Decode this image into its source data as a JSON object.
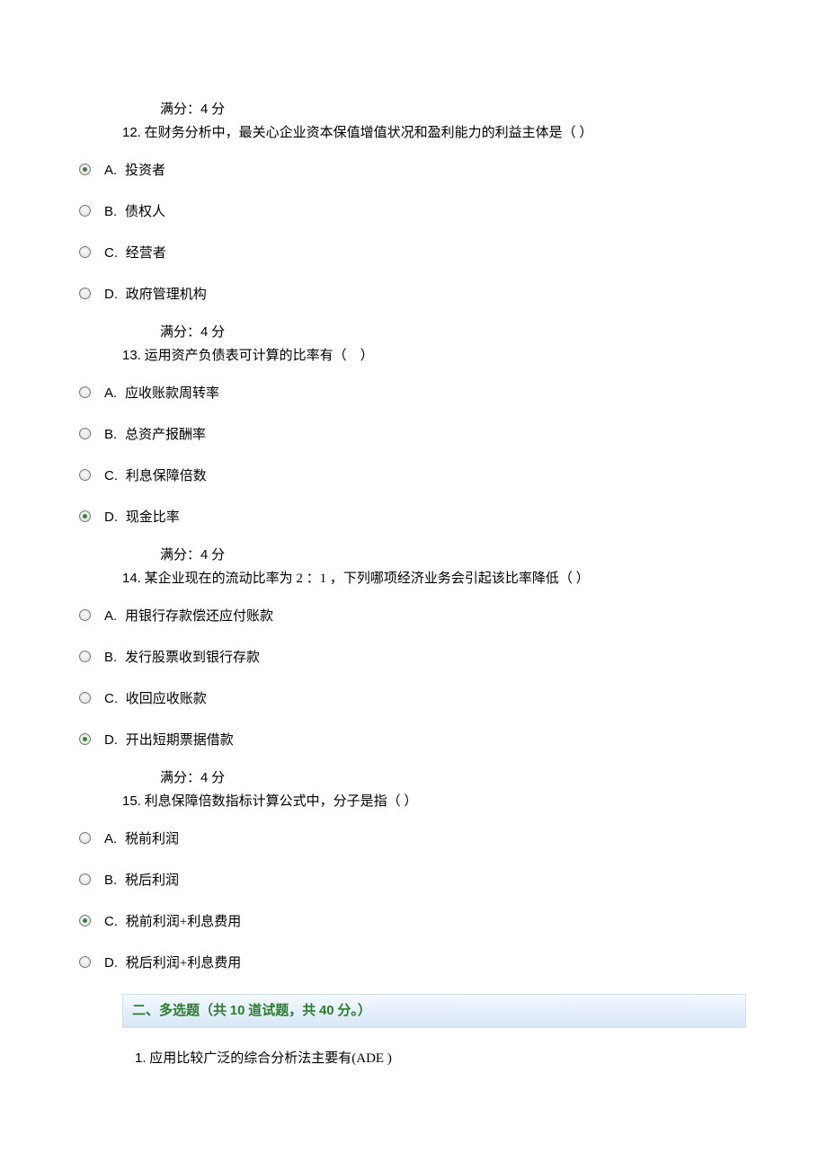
{
  "score_label_prefix": "满分：",
  "score_value": "4",
  "score_label_suffix": " 分",
  "questions": [
    {
      "number": "12.",
      "text": " 在财务分析中，最关心企业资本保值增值状况和盈利能力的利益主体是（ ）",
      "selected": 0,
      "options": [
        {
          "label": "A.",
          "text": " 投资者"
        },
        {
          "label": "B.",
          "text": " 债权人"
        },
        {
          "label": "C.",
          "text": " 经营者"
        },
        {
          "label": "D.",
          "text": " 政府管理机构"
        }
      ]
    },
    {
      "number": "13.",
      "text": " 运用资产负债表可计算的比率有（　）",
      "selected": 3,
      "options": [
        {
          "label": "A.",
          "text": " 应收账款周转率"
        },
        {
          "label": "B.",
          "text": " 总资产报酬率"
        },
        {
          "label": "C.",
          "text": " 利息保障倍数"
        },
        {
          "label": "D.",
          "text": " 现金比率"
        }
      ]
    },
    {
      "number": "14.",
      "text": " 某企业现在的流动比率为 2 ：1 ，下列哪项经济业务会引起该比率降低（ ）",
      "selected": 3,
      "options": [
        {
          "label": "A.",
          "text": " 用银行存款偿还应付账款"
        },
        {
          "label": "B.",
          "text": " 发行股票收到银行存款"
        },
        {
          "label": "C.",
          "text": " 收回应收账款"
        },
        {
          "label": "D.",
          "text": " 开出短期票据借款"
        }
      ]
    },
    {
      "number": "15.",
      "text": " 利息保障倍数指标计算公式中，分子是指（ ）",
      "selected": 2,
      "options": [
        {
          "label": "A.",
          "text": " 税前利润"
        },
        {
          "label": "B.",
          "text": " 税后利润"
        },
        {
          "label": "C.",
          "text": " 税前利润+利息费用"
        },
        {
          "label": "D.",
          "text": " 税后利润+利息费用"
        }
      ]
    }
  ],
  "section2": {
    "prefix": "二、多选题（共 ",
    "count1": "10",
    "mid": " 道试题，共 ",
    "count2": "40",
    "suffix": " 分。）"
  },
  "mc_question": {
    "number": "1.",
    "text": " 应用比较广泛的综合分析法主要有(ADE )"
  }
}
